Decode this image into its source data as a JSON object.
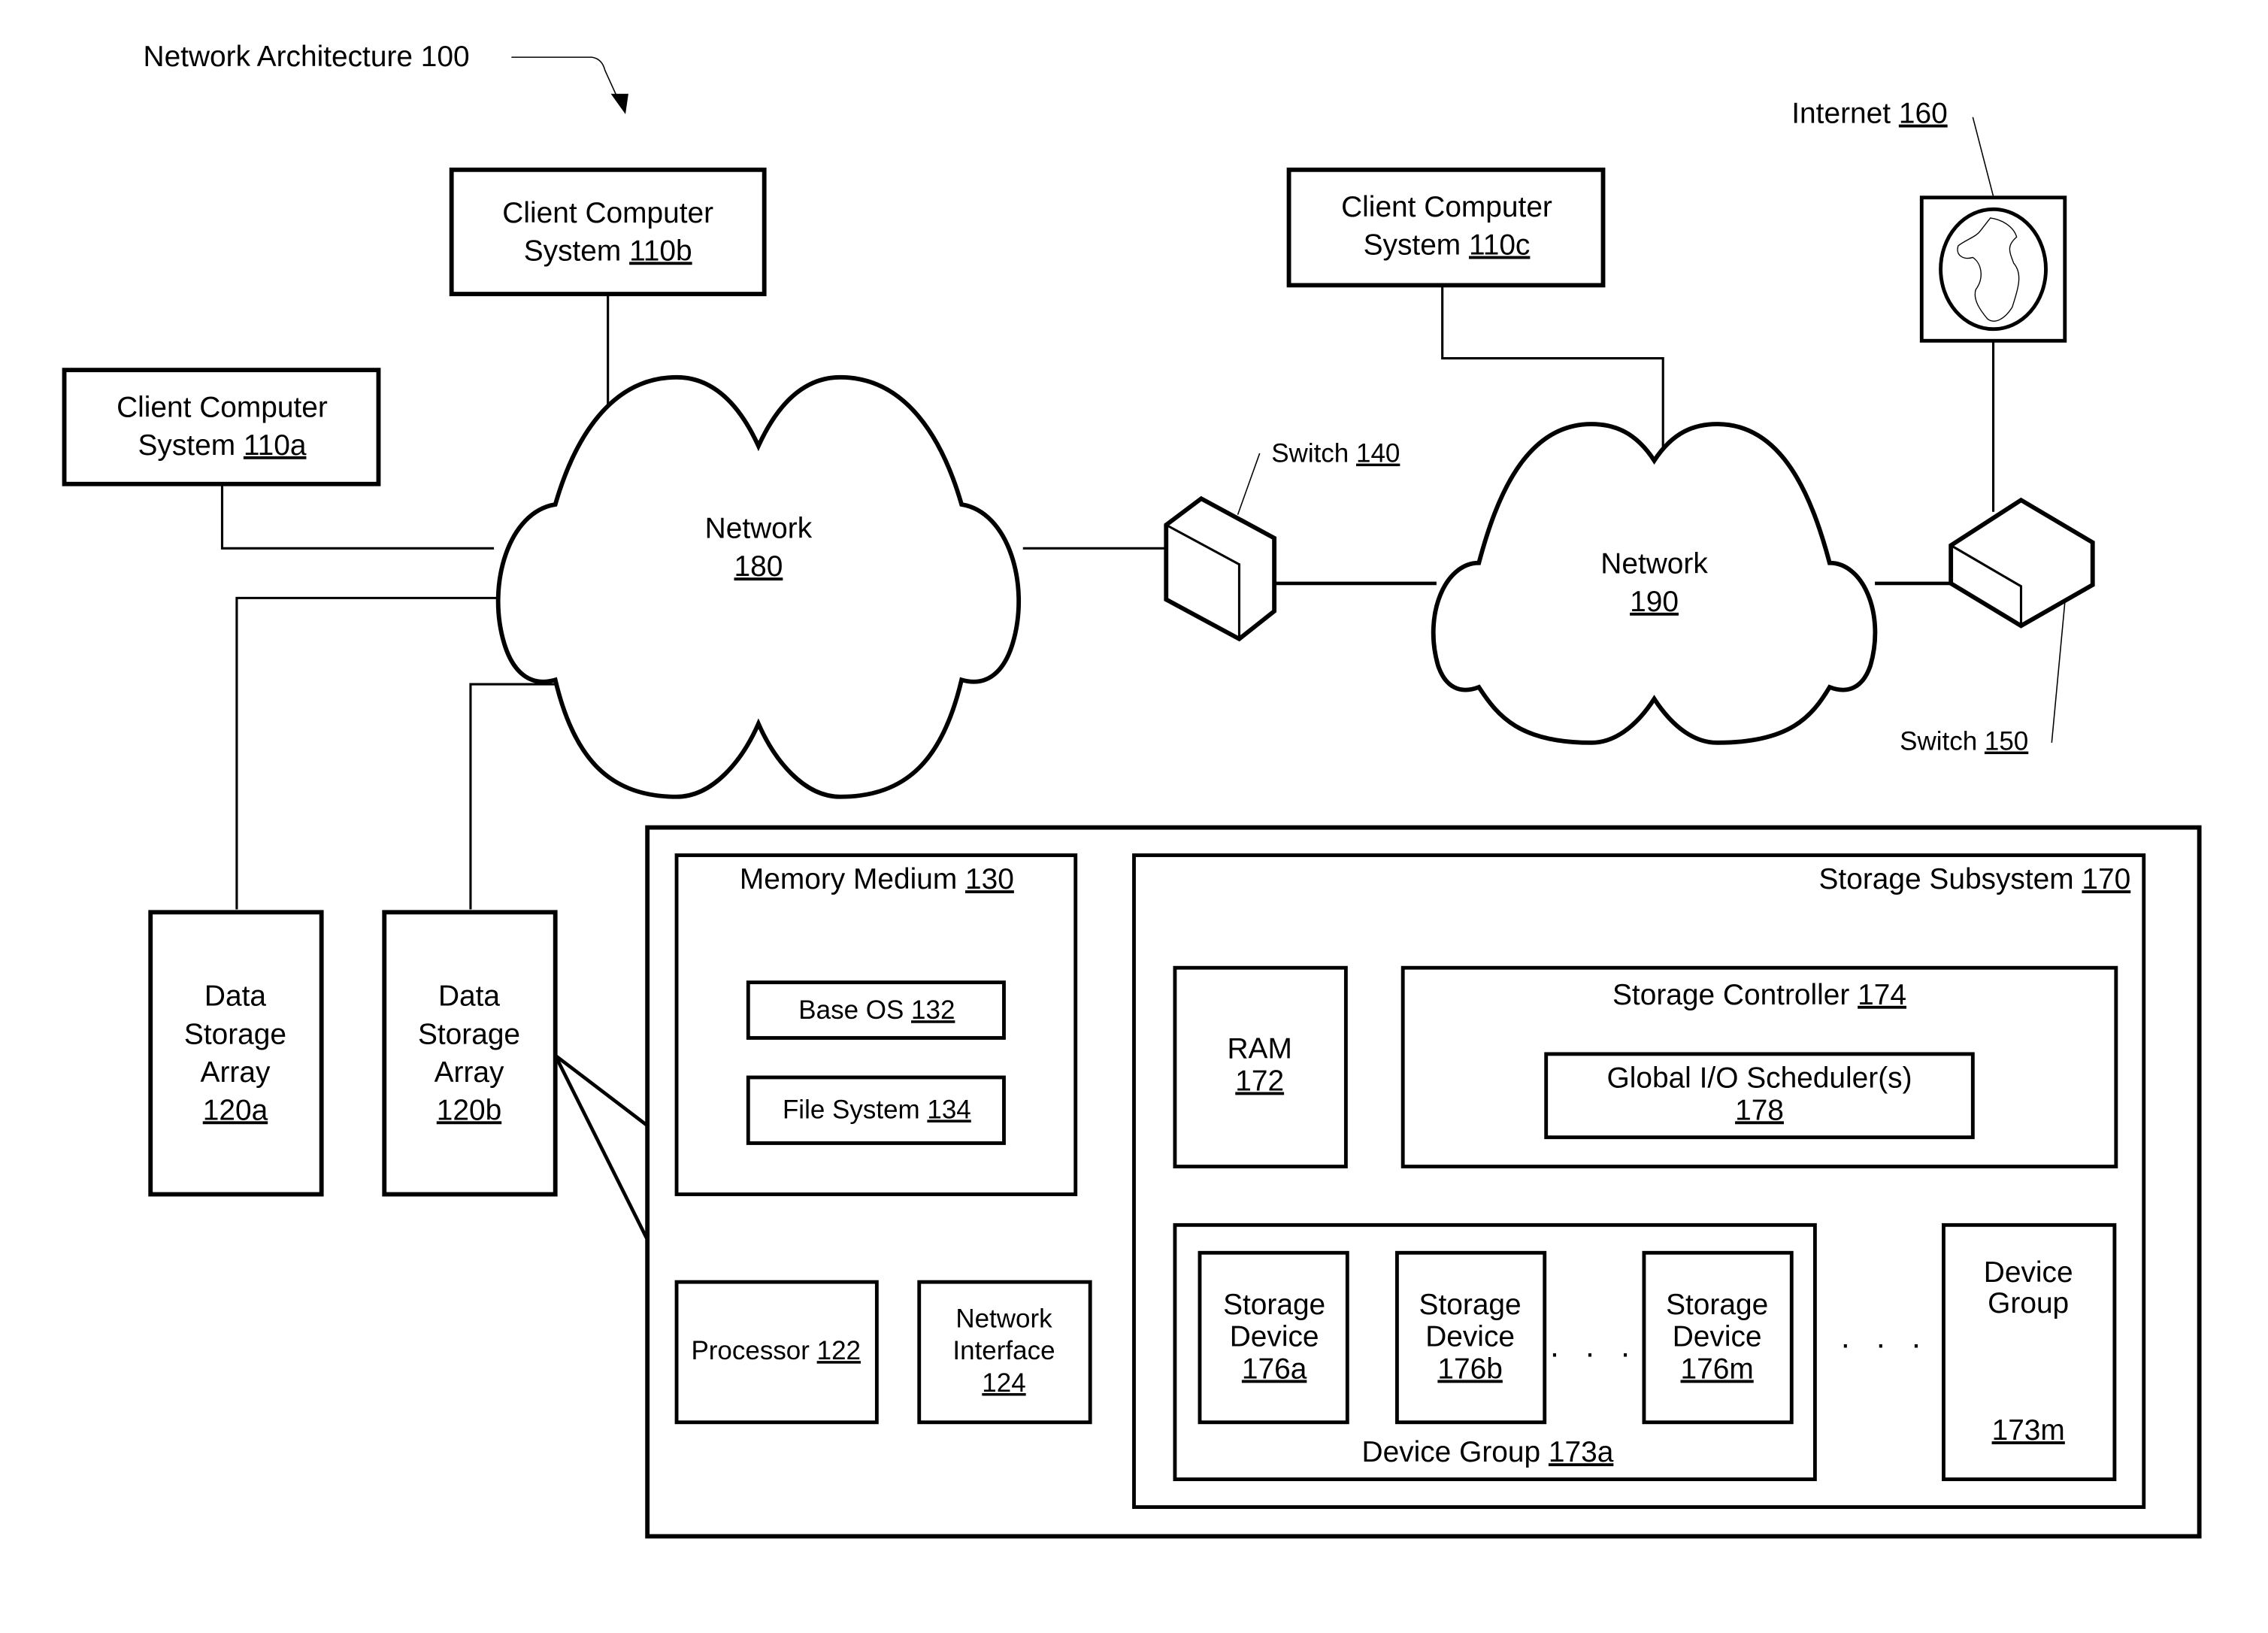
{
  "figure": {
    "title": "Network Architecture 100",
    "colors": {
      "stroke": "#000000",
      "background": "#ffffff"
    }
  },
  "clients": [
    {
      "id": "110a",
      "line1": "Client Computer",
      "line2": "System ",
      "ref": "110a"
    },
    {
      "id": "110b",
      "line1": "Client Computer",
      "line2": "System ",
      "ref": "110b"
    },
    {
      "id": "110c",
      "line1": "Client Computer",
      "line2": "System ",
      "ref": "110c"
    }
  ],
  "networks": [
    {
      "label": "Network",
      "ref": "180"
    },
    {
      "label": "Network",
      "ref": "190"
    }
  ],
  "switches": [
    {
      "label": "Switch ",
      "ref": "140"
    },
    {
      "label": "Switch ",
      "ref": "150"
    }
  ],
  "internet": {
    "label": "Internet ",
    "ref": "160",
    "icon": "globe-icon"
  },
  "storage_arrays": [
    {
      "lines": [
        "Data",
        "Storage",
        "Array"
      ],
      "ref": "120a"
    },
    {
      "lines": [
        "Data",
        "Storage",
        "Array"
      ],
      "ref": "120b"
    }
  ],
  "detail": {
    "memory_medium": {
      "label": "Memory Medium ",
      "ref": "130"
    },
    "base_os": {
      "label": "Base OS ",
      "ref": "132"
    },
    "file_system": {
      "label": "File System ",
      "ref": "134"
    },
    "processor": {
      "label": "Processor ",
      "ref": "122"
    },
    "network_interface": {
      "line1": "Network",
      "line2": "Interface",
      "ref": "124"
    },
    "storage_subsystem": {
      "label": "Storage Subsystem ",
      "ref": "170"
    },
    "ram": {
      "label": "RAM",
      "ref": "172"
    },
    "storage_controller": {
      "label": "Storage Controller ",
      "ref": "174"
    },
    "io_scheduler": {
      "label": "Global I/O Scheduler(s)",
      "ref": "178"
    },
    "device_group_a": {
      "label": "Device Group ",
      "ref": "173a"
    },
    "device_group_m": {
      "line1": "Device",
      "line2": "Group",
      "ref": "173m"
    },
    "storage_devices": [
      {
        "line1": "Storage",
        "line2": "Device",
        "ref": "176a"
      },
      {
        "line1": "Storage",
        "line2": "Device",
        "ref": "176b"
      },
      {
        "line1": "Storage",
        "line2": "Device",
        "ref": "176m"
      }
    ],
    "ellipsis": ". . ."
  }
}
